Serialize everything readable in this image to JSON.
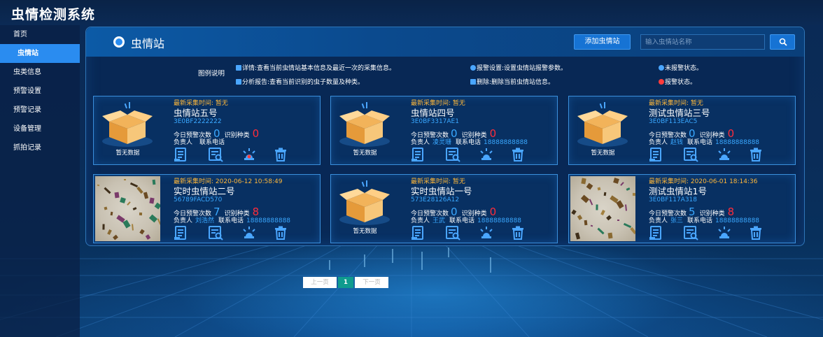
{
  "app": {
    "title": "虫情检测系统"
  },
  "sidebar": {
    "items": [
      {
        "label": "首页",
        "active": false
      },
      {
        "label": "虫情站",
        "active": true
      },
      {
        "label": "虫类信息",
        "active": false
      },
      {
        "label": "预警设置",
        "active": false
      },
      {
        "label": "预警记录",
        "active": false
      },
      {
        "label": "设备管理",
        "active": false
      },
      {
        "label": "抓拍记录",
        "active": false
      }
    ]
  },
  "panel": {
    "title": "虫情站",
    "add_button": "添加虫情站",
    "search_placeholder": "输入虫情站名称",
    "search_value": ""
  },
  "legend": {
    "label": "图例说明",
    "items": [
      {
        "icon": "detail-icon",
        "text": "详情:查看当前虫情站基本信息及最近一次的采集信息。"
      },
      {
        "icon": "analysis-report-icon",
        "text": "分析报告:查看当前识别的虫子数量及种类。"
      },
      {
        "icon": "alarm-settings-icon",
        "text": "报警设置:设置虫情站报警参数。"
      },
      {
        "icon": "delete-icon",
        "text": "删除:删除当前虫情站信息。"
      },
      {
        "icon": "not-alarmed-icon",
        "text": "未报警状态。"
      },
      {
        "icon": "alarmed-icon",
        "text": "报警状态。"
      }
    ]
  },
  "labels": {
    "latest_time_prefix": "最新采集时间: ",
    "today_alerts": "今日预警次数",
    "species": "识别种类",
    "person": "负责人",
    "phone": "联系电话",
    "no_data": "暂无数据"
  },
  "stations": [
    {
      "latest_time": "暂无",
      "name": "虫情站五号",
      "code": "3E0BF2222222",
      "alerts": "0",
      "species": "0",
      "person": "",
      "phone": "",
      "has_photo": false,
      "alarm": "alarmed"
    },
    {
      "latest_time": "暂无",
      "name": "虫情站四号",
      "code": "3E0BF3317AE1",
      "alerts": "0",
      "species": "0",
      "person": "凌灵珊",
      "phone": "18888888888",
      "has_photo": false,
      "alarm": "not-alarmed"
    },
    {
      "latest_time": "暂无",
      "name": "测试虫情站三号",
      "code": "3E0BF113EAC5",
      "alerts": "0",
      "species": "0",
      "person": "赵钱",
      "phone": "18888888888",
      "has_photo": false,
      "alarm": "not-alarmed"
    },
    {
      "latest_time": "2020-06-12 10:58:49",
      "name": "实时虫情站二号",
      "code": "56789FACD570",
      "alerts": "7",
      "species": "8",
      "person": "刘浩然",
      "phone": "18888888888",
      "has_photo": true,
      "alarm": "not-alarmed"
    },
    {
      "latest_time": "暂无",
      "name": "实时虫情站一号",
      "code": "573E28126A12",
      "alerts": "0",
      "species": "0",
      "person": "王武",
      "phone": "18888888888",
      "has_photo": false,
      "alarm": "not-alarmed"
    },
    {
      "latest_time": "2020-06-01 18:14:36",
      "name": "测试虫情站1号",
      "code": "3E0BF117A318",
      "alerts": "5",
      "species": "8",
      "person": "张三",
      "phone": "18888888888",
      "has_photo": true,
      "alarm": "not-alarmed"
    }
  ],
  "pagination": {
    "prev": "上一页",
    "current": "1",
    "next": "下一页"
  },
  "colors": {
    "accent": "#2a8cf0",
    "time": "#ffb83a",
    "count_blue": "#3aa8ff",
    "count_red": "#ff2c3a",
    "page_active": "#0f9b8e"
  }
}
